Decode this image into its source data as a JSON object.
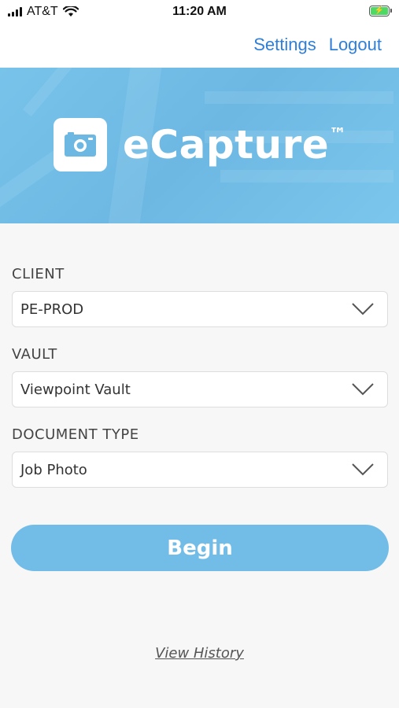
{
  "status_bar": {
    "carrier": "AT&T",
    "time": "11:20 AM"
  },
  "nav": {
    "settings_label": "Settings",
    "logout_label": "Logout"
  },
  "hero": {
    "app_name": "eCapture",
    "trademark": "™"
  },
  "form": {
    "client": {
      "label": "CLIENT",
      "value": "PE-PROD"
    },
    "vault": {
      "label": "VAULT",
      "value": "Viewpoint Vault"
    },
    "document_type": {
      "label": "DOCUMENT TYPE",
      "value": "Job Photo"
    }
  },
  "begin_label": "Begin",
  "view_history_label": "View History",
  "colors": {
    "accent": "#72bde8",
    "link": "#2f7fd8",
    "background": "#f7f7f7"
  }
}
